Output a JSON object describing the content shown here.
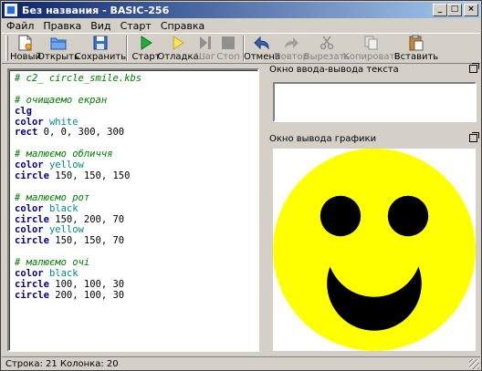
{
  "window": {
    "title": "Без названия - BASIC-256",
    "buttons": {
      "minimize": "_",
      "maximize": "□",
      "close": "×"
    }
  },
  "menu": [
    "Файл",
    "Правка",
    "Вид",
    "Старт",
    "Справка"
  ],
  "toolbar": {
    "new": "Новый",
    "open": "Открыть",
    "save": "Сохранить",
    "run": "Старт",
    "debug": "Отладка",
    "step": "Шаг",
    "stop": "Стоп",
    "undo": "Отмена",
    "redo": "Повтор",
    "cut": "Вырезать",
    "copy": "Копировать",
    "paste": "Вставить"
  },
  "editor": {
    "lines": [
      {
        "type": "comment",
        "text": "# c2_ circle_smile.kbs"
      },
      {
        "type": "blank",
        "text": ""
      },
      {
        "type": "comment",
        "text": "# очищаемо екран"
      },
      {
        "type": "cmd",
        "kw": "clg",
        "arg": ""
      },
      {
        "type": "cmd",
        "kw": "color",
        "arg": "white",
        "argtype": "color"
      },
      {
        "type": "cmd",
        "kw": "rect",
        "arg": "0, 0, 300, 300",
        "argtype": "num"
      },
      {
        "type": "blank",
        "text": ""
      },
      {
        "type": "comment",
        "text": "# малюємо обличчя"
      },
      {
        "type": "cmd",
        "kw": "color",
        "arg": "yellow",
        "argtype": "color"
      },
      {
        "type": "cmd",
        "kw": "circle",
        "arg": "150, 150, 150",
        "argtype": "num"
      },
      {
        "type": "blank",
        "text": ""
      },
      {
        "type": "comment",
        "text": "# малюємо рот"
      },
      {
        "type": "cmd",
        "kw": "color",
        "arg": "black",
        "argtype": "color"
      },
      {
        "type": "cmd",
        "kw": "circle",
        "arg": "150, 200, 70",
        "argtype": "num"
      },
      {
        "type": "cmd",
        "kw": "color",
        "arg": "yellow",
        "argtype": "color"
      },
      {
        "type": "cmd",
        "kw": "circle",
        "arg": "150, 150, 70",
        "argtype": "num"
      },
      {
        "type": "blank",
        "text": ""
      },
      {
        "type": "comment",
        "text": "# малюємо очі"
      },
      {
        "type": "cmd",
        "kw": "color",
        "arg": "black",
        "argtype": "color"
      },
      {
        "type": "cmd",
        "kw": "circle",
        "arg": "100, 100, 30",
        "argtype": "num"
      },
      {
        "type": "cmd",
        "kw": "circle",
        "arg": "200, 100, 30",
        "argtype": "num"
      }
    ]
  },
  "text_panel": {
    "title": "Окно ввода-вывода текста"
  },
  "graphics_panel": {
    "title": "Окно вывода графики"
  },
  "status": "Строка: 21 Колонка: 20",
  "colors": {
    "face": "#ffff00",
    "features": "#000000",
    "background": "#ffffff",
    "title_start": "#0a246a",
    "title_end": "#a6caf0"
  }
}
